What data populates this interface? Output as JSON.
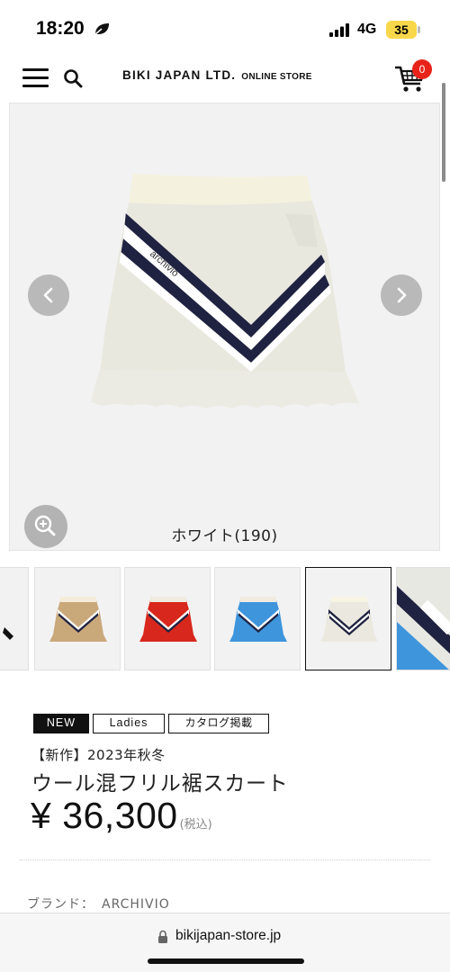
{
  "status_bar": {
    "time": "18:20",
    "network": "4G",
    "battery": "35"
  },
  "header": {
    "brand": "BIKI JAPAN LTD.",
    "brand_sub": "ONLINE STORE",
    "cart_count": "0"
  },
  "product_image": {
    "color_caption": "ホワイト(190)",
    "logo_text": "archivio"
  },
  "thumbnails": [
    {
      "color": "#111111",
      "label": "partial"
    },
    {
      "color": "#c9a87a",
      "label": "beige"
    },
    {
      "color": "#d8271c",
      "label": "red"
    },
    {
      "color": "#3e95dc",
      "label": "blue"
    },
    {
      "color": "#ebe9df",
      "label": "white",
      "selected": true
    },
    {
      "color": "#3e95dc",
      "label": "detail"
    }
  ],
  "product": {
    "tags": [
      "NEW",
      "Ladies",
      "カタログ掲載"
    ],
    "subtitle": "【新作】2023年秋冬",
    "name": "ウール混フリル裾スカート",
    "price": "¥ 36,300",
    "tax_note": "(税込)",
    "brand_label": "ブランド：",
    "brand_value": "ARCHIVIO"
  },
  "browser": {
    "url": "bikijapan-store.jp"
  },
  "colors": {
    "cart_badge": "#e8231a",
    "tag_new_bg": "#111111"
  }
}
